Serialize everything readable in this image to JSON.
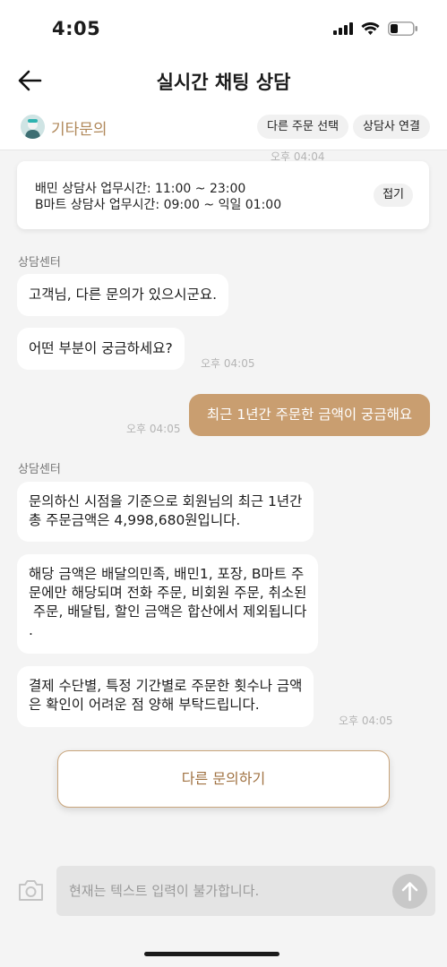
{
  "status_bar": {
    "time": "4:05"
  },
  "header": {
    "title": "실시간 채팅 상담"
  },
  "sub_header": {
    "category": "기타문의",
    "chips": [
      "다른 주문 선택",
      "상담사 연결"
    ]
  },
  "notice": {
    "timestamp": "오후 04:04",
    "line1": "배민 상담사 업무시간: 11:00 ~ 23:00",
    "line2": "B마트 상담사 업무시간: 09:00 ~ 익일 01:00",
    "collapse_label": "접기"
  },
  "messages": {
    "group1": {
      "sender": "상담센터",
      "bubbles": [
        "고객님, 다른 문의가 있으시군요.",
        "어떤 부분이 궁금하세요?"
      ],
      "timestamp": "오후 04:05"
    },
    "mine": {
      "text": "최근 1년간 주문한 금액이 궁금해요",
      "timestamp": "오후 04:05"
    },
    "group2": {
      "sender": "상담센터",
      "bubble1": [
        "문의하신 시점을 기준으로 회원님의 최근 1년간",
        "총 주문금액은 4,998,680원입니다."
      ],
      "bubble2": [
        "해당 금액은 배달의민족, 배민1, 포장, B마트 주",
        "문에만 해당되며 전화 주문, 비회원 주문, 취소된",
        " 주문, 배달팁, 할인 금액은 합산에서 제외됩니다",
        "."
      ],
      "bubble3": [
        "결제 수단별, 특정 기간별로 주문한 횟수나 금액",
        "은 확인이 어려운 점 양해 부탁드립니다."
      ],
      "timestamp": "오후 04:05"
    }
  },
  "other_inquiry_button": "다른 문의하기",
  "composer": {
    "placeholder": "현재는 텍스트 입력이 불가합니다."
  },
  "colors": {
    "accent": "#c99e70",
    "accent_text": "#a07242",
    "category": "#b0885a"
  }
}
